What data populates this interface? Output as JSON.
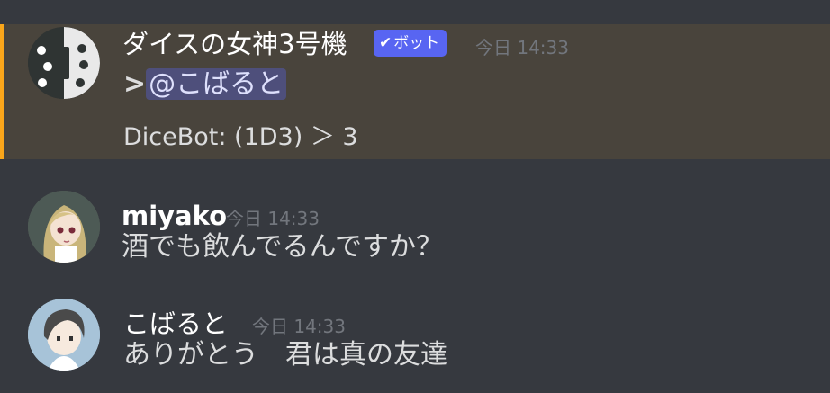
{
  "messages": [
    {
      "username": "ダイスの女神3号機",
      "bot_tag": "ボット",
      "bot_check": "✔",
      "timestamp": "今日 14:33",
      "line1_prefix": ">",
      "line1_mention": "@こばると",
      "line2": "DiceBot: (1D3) ＞ 3",
      "avatar_icon": "dice-icon",
      "highlight_color": "#faa61a"
    },
    {
      "username": "miyako",
      "timestamp": "今日 14:33",
      "text": "酒でも飲んでるんですか？",
      "avatar_icon": "anime-girl-avatar"
    },
    {
      "username": "こばると",
      "timestamp": "今日 14:33",
      "text": "ありがとう　君は真の友達",
      "avatar_icon": "anime-boy-avatar"
    }
  ],
  "colors": {
    "background": "#36393f",
    "bot_tag": "#5865f2",
    "mention_bg": "#49443c",
    "timestamp": "#72767d"
  }
}
